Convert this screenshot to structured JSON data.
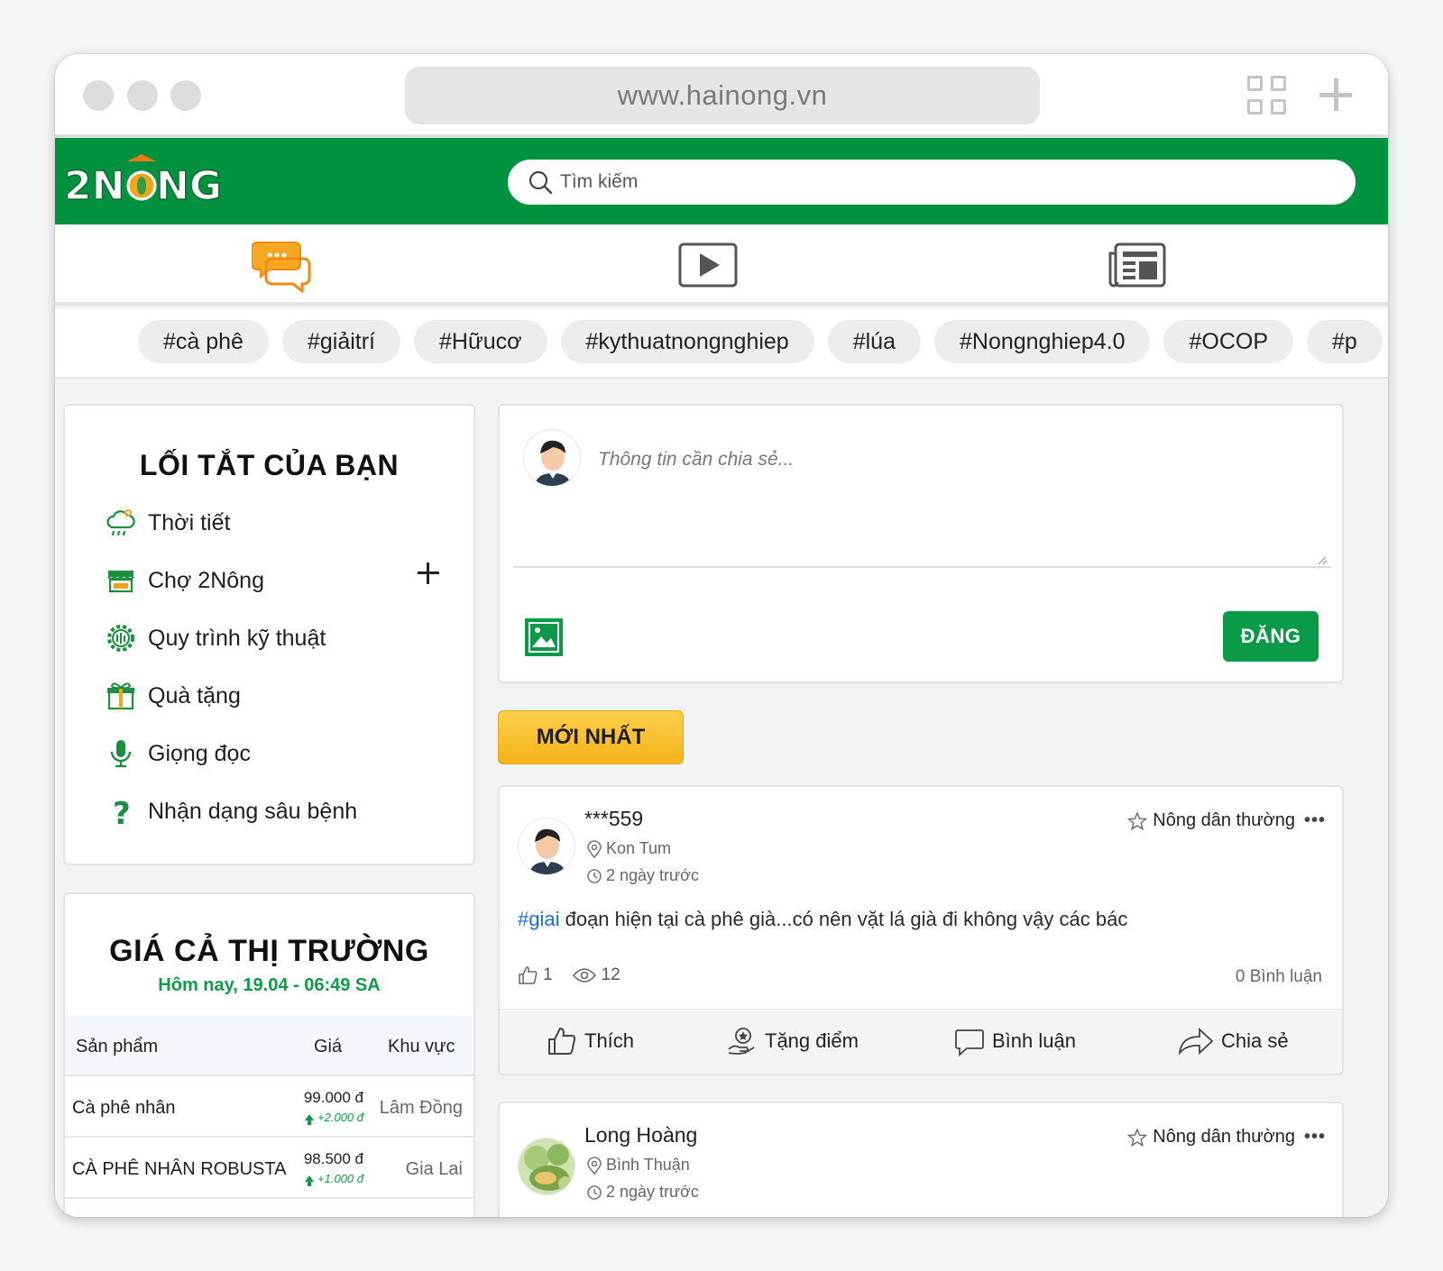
{
  "browser": {
    "url": "www.hainong.vn"
  },
  "header": {
    "logo_text": "2NONG",
    "search_placeholder": "Tìm kiếm",
    "brand_color": "#00923f"
  },
  "icon_nav": [
    {
      "icon": "chat-bubbles-icon",
      "active": true
    },
    {
      "icon": "video-play-icon",
      "active": false
    },
    {
      "icon": "newspaper-icon",
      "active": false
    }
  ],
  "tags": [
    "#cà phê",
    "#giảitrí",
    "#Hữucơ",
    "#kythuatnongnghiep",
    "#lúa",
    "#Nongnghiep4.0",
    "#OCOP",
    "#p"
  ],
  "shortcuts": {
    "title": "LỐI TẮT CỦA BẠN",
    "items": [
      {
        "label": "Thời tiết",
        "icon": "weather-cloud-icon"
      },
      {
        "label": "Chợ 2Nông",
        "icon": "market-stall-icon"
      },
      {
        "label": "Quy trình kỹ thuật",
        "icon": "gear-process-icon"
      },
      {
        "label": "Quà tặng",
        "icon": "gift-icon"
      },
      {
        "label": "Giọng đọc",
        "icon": "microphone-icon"
      },
      {
        "label": "Nhận dạng sâu bệnh",
        "icon": "question-mark-icon"
      }
    ]
  },
  "market": {
    "title": "GIÁ CẢ THỊ TRƯỜNG",
    "subtitle": "Hôm nay, 19.04 - 06:49 SA",
    "columns": [
      "Sản phẩm",
      "Giá",
      "Khu vực"
    ],
    "rows": [
      {
        "product": "Cà phê nhân",
        "price": "99.000 đ",
        "change": "+2.000 đ",
        "region": "Lâm Đồng"
      },
      {
        "product": "CÀ PHÊ NHÂN ROBUSTA",
        "price": "98.500 đ",
        "change": "+1.000 đ",
        "region": "Gia Lai"
      }
    ]
  },
  "composer": {
    "placeholder": "Thông tin cần chia sẻ...",
    "post_button": "ĐĂNG"
  },
  "feed": {
    "newest_label": "MỚI NHẤT",
    "posts": [
      {
        "author": "***559",
        "location": "Kon Tum",
        "time": "2 ngày trước",
        "rank": "Nông dân thường",
        "hashtag": "#giai",
        "text": " đoạn hiện tại cà phê già...có nên vặt lá già đi không vậy các bác",
        "likes": "1",
        "views": "12",
        "comments": "0 Bình luận"
      },
      {
        "author": "Long Hoàng",
        "location": "Bình Thuận",
        "time": "2 ngày trước",
        "rank": "Nông dân thường"
      }
    ],
    "actions": {
      "like": "Thích",
      "give_points": "Tặng điểm",
      "comment": "Bình luận",
      "share": "Chia sẻ"
    }
  }
}
